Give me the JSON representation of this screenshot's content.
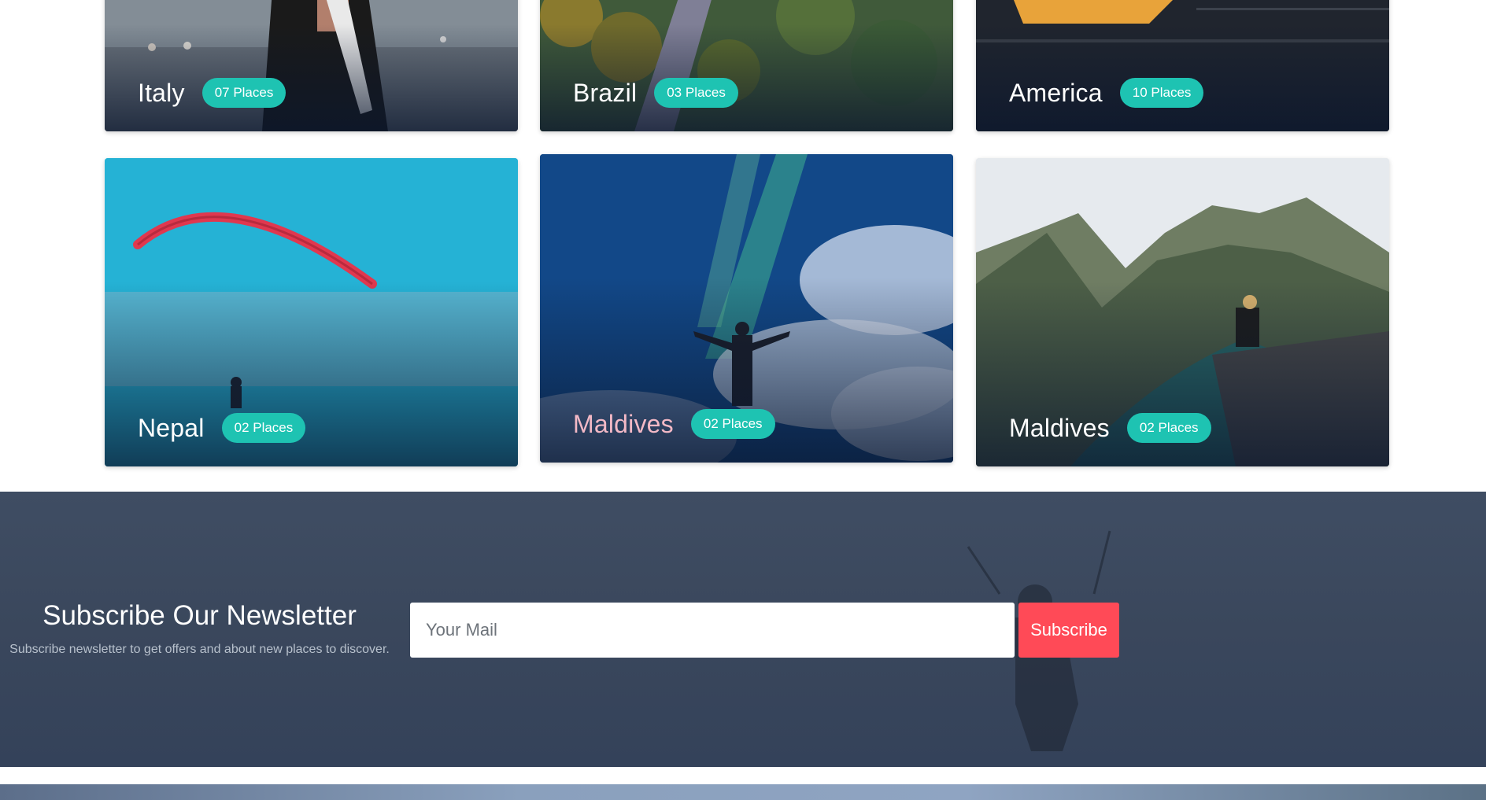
{
  "destinations": [
    {
      "country": "Italy",
      "places": "07 Places"
    },
    {
      "country": "Brazil",
      "places": "03 Places"
    },
    {
      "country": "America",
      "places": "10 Places"
    },
    {
      "country": "Nepal",
      "places": "02 Places"
    },
    {
      "country": "Maldives",
      "places": "02 Places"
    },
    {
      "country": "Maldives",
      "places": "02 Places"
    }
  ],
  "newsletter": {
    "title": "Subscribe Our Newsletter",
    "subtitle": "Subscribe newsletter to get offers and about new places to discover.",
    "input_placeholder": "Your Mail",
    "button_label": "Subscribe"
  },
  "colors": {
    "badge": "#1ec3b2",
    "subscribe_button": "#ff4a57",
    "newsletter_bg": "#3f4d63",
    "hover_country": "#f3b9c6"
  }
}
